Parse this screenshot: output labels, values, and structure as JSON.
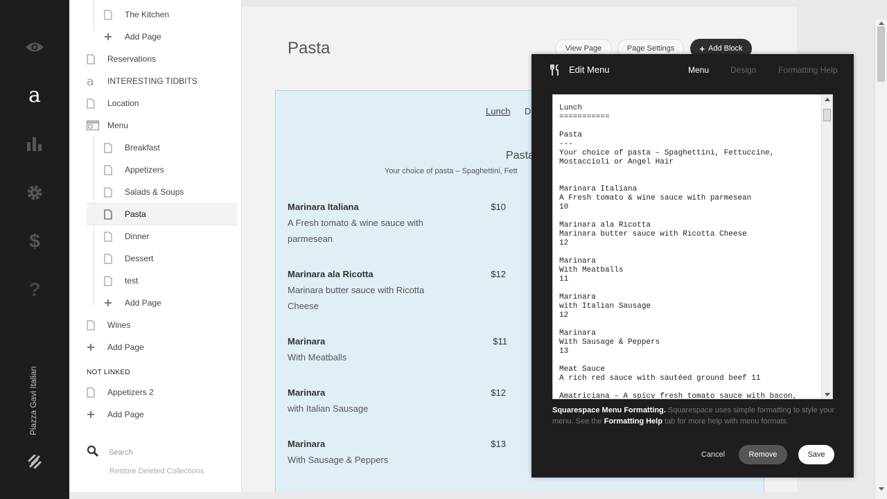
{
  "rail": {
    "logo_letter": "a",
    "site_name": "Piazza Gavi Italian"
  },
  "tree": {
    "items": [
      {
        "label": "The Kitchen",
        "icon": "page-icon"
      },
      {
        "label": "Add Page",
        "icon": "plus-icon"
      },
      {
        "label": "Reservations",
        "icon": "page-icon"
      },
      {
        "label": "INTERESTING TIDBITS",
        "icon": "blog-icon"
      },
      {
        "label": "Location",
        "icon": "page-icon"
      },
      {
        "label": "Menu",
        "icon": "folder-icon"
      },
      {
        "label": "Breakfast",
        "icon": "page-icon"
      },
      {
        "label": "Appetizers",
        "icon": "page-icon"
      },
      {
        "label": "Salads & Soups",
        "icon": "page-icon"
      },
      {
        "label": "Pasta",
        "icon": "page-icon"
      },
      {
        "label": "Dinner",
        "icon": "page-icon"
      },
      {
        "label": "Dessert",
        "icon": "page-icon"
      },
      {
        "label": "test",
        "icon": "page-icon"
      },
      {
        "label": "Add Page",
        "icon": "plus-icon"
      },
      {
        "label": "Wines",
        "icon": "page-icon"
      },
      {
        "label": "Add Page",
        "icon": "plus-icon"
      }
    ],
    "not_linked_heading": "NOT LINKED",
    "not_linked": [
      {
        "label": "Appetizers 2",
        "icon": "page-icon"
      },
      {
        "label": "Add Page",
        "icon": "plus-icon"
      }
    ],
    "search_placeholder": "Search",
    "restore_label": "Restore Deleted Collections"
  },
  "main": {
    "page_title": "Pasta",
    "buttons": {
      "view_page": "View Page",
      "page_settings": "Page Settings",
      "add_block": "Add Block"
    },
    "menu_block": {
      "tab_lunch": "Lunch",
      "tab_partial": "D",
      "section_title": "Pasta",
      "section_desc": "Your choice of pasta – Spaghettini, Fett",
      "items": [
        {
          "name": "Marinara Italiana",
          "desc": "A Fresh tomato & wine sauce with parmesean",
          "price": "$10"
        },
        {
          "name": "Marinara ala Ricotta",
          "desc": "Marinara butter sauce with Ricotta Cheese",
          "price": "$12"
        },
        {
          "name": "Marinara",
          "desc": "With Meatballs",
          "price": "$11"
        },
        {
          "name": "Marinara",
          "desc": "with Italian Sausage",
          "price": "$12"
        },
        {
          "name": "Marinara",
          "desc": "With Sausage & Peppers",
          "price": "$13"
        }
      ]
    }
  },
  "modal": {
    "title": "Edit Menu",
    "tabs": {
      "menu": "Menu",
      "design": "Design",
      "formatting_help": "Formatting Help"
    },
    "editor_text": "Lunch\n===========\n\nPasta\n---\nYour choice of pasta – Spaghettini, Fettuccine,\nMostaccioli or Angel Hair\n\n\nMarinara Italiana\nA Fresh tomato & wine sauce with parmesean\n10\n\nMarinara ala Ricotta\nMarinara butter sauce with Ricotta Cheese\n12\n\nMarinara\nWith Meatballs\n11\n\nMarinara\nwith Italian Sausage\n12\n\nMarinara\nWith Sausage & Peppers\n13\n\nMeat Sauce\nA rich red sauce with sautéed ground beef 11\n\nAmatriciana – A spicy fresh tomato sauce with bacon,",
    "help_bold": "Squarespace Menu Formatting.",
    "help_text_1": " Squarespace uses simple formatting to style your menu. See the ",
    "help_link": "Formatting Help",
    "help_text_2": " tab for more help with menu formats.",
    "buttons": {
      "cancel": "Cancel",
      "remove": "Remove",
      "save": "Save"
    }
  },
  "colors": {
    "rail_bg": "#1d1d1d",
    "modal_bg": "#1e1e1e",
    "block_bg": "#e0eff6",
    "block_border": "#b8d2df"
  }
}
